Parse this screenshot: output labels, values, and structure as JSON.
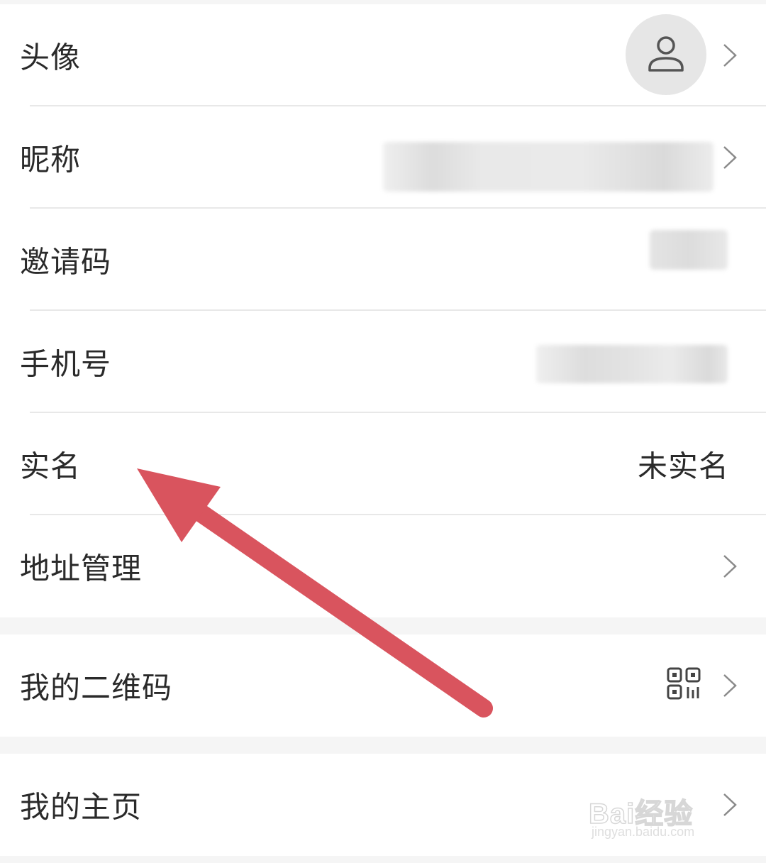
{
  "rows": [
    {
      "label": "头像"
    },
    {
      "label": "昵称"
    },
    {
      "label": "邀请码"
    },
    {
      "label": "手机号"
    },
    {
      "label": "实名",
      "value": "未实名"
    },
    {
      "label": "地址管理"
    },
    {
      "label": "我的二维码"
    },
    {
      "label": "我的主页"
    }
  ],
  "icons": {
    "avatar": "user-icon",
    "chevron": "chevron-right-icon",
    "qr": "qr-code-icon"
  },
  "annotation": {
    "color": "#d9545e",
    "type": "arrow"
  },
  "watermark": {
    "brand": "Bai经验",
    "url": "jingyan.baidu.com"
  }
}
